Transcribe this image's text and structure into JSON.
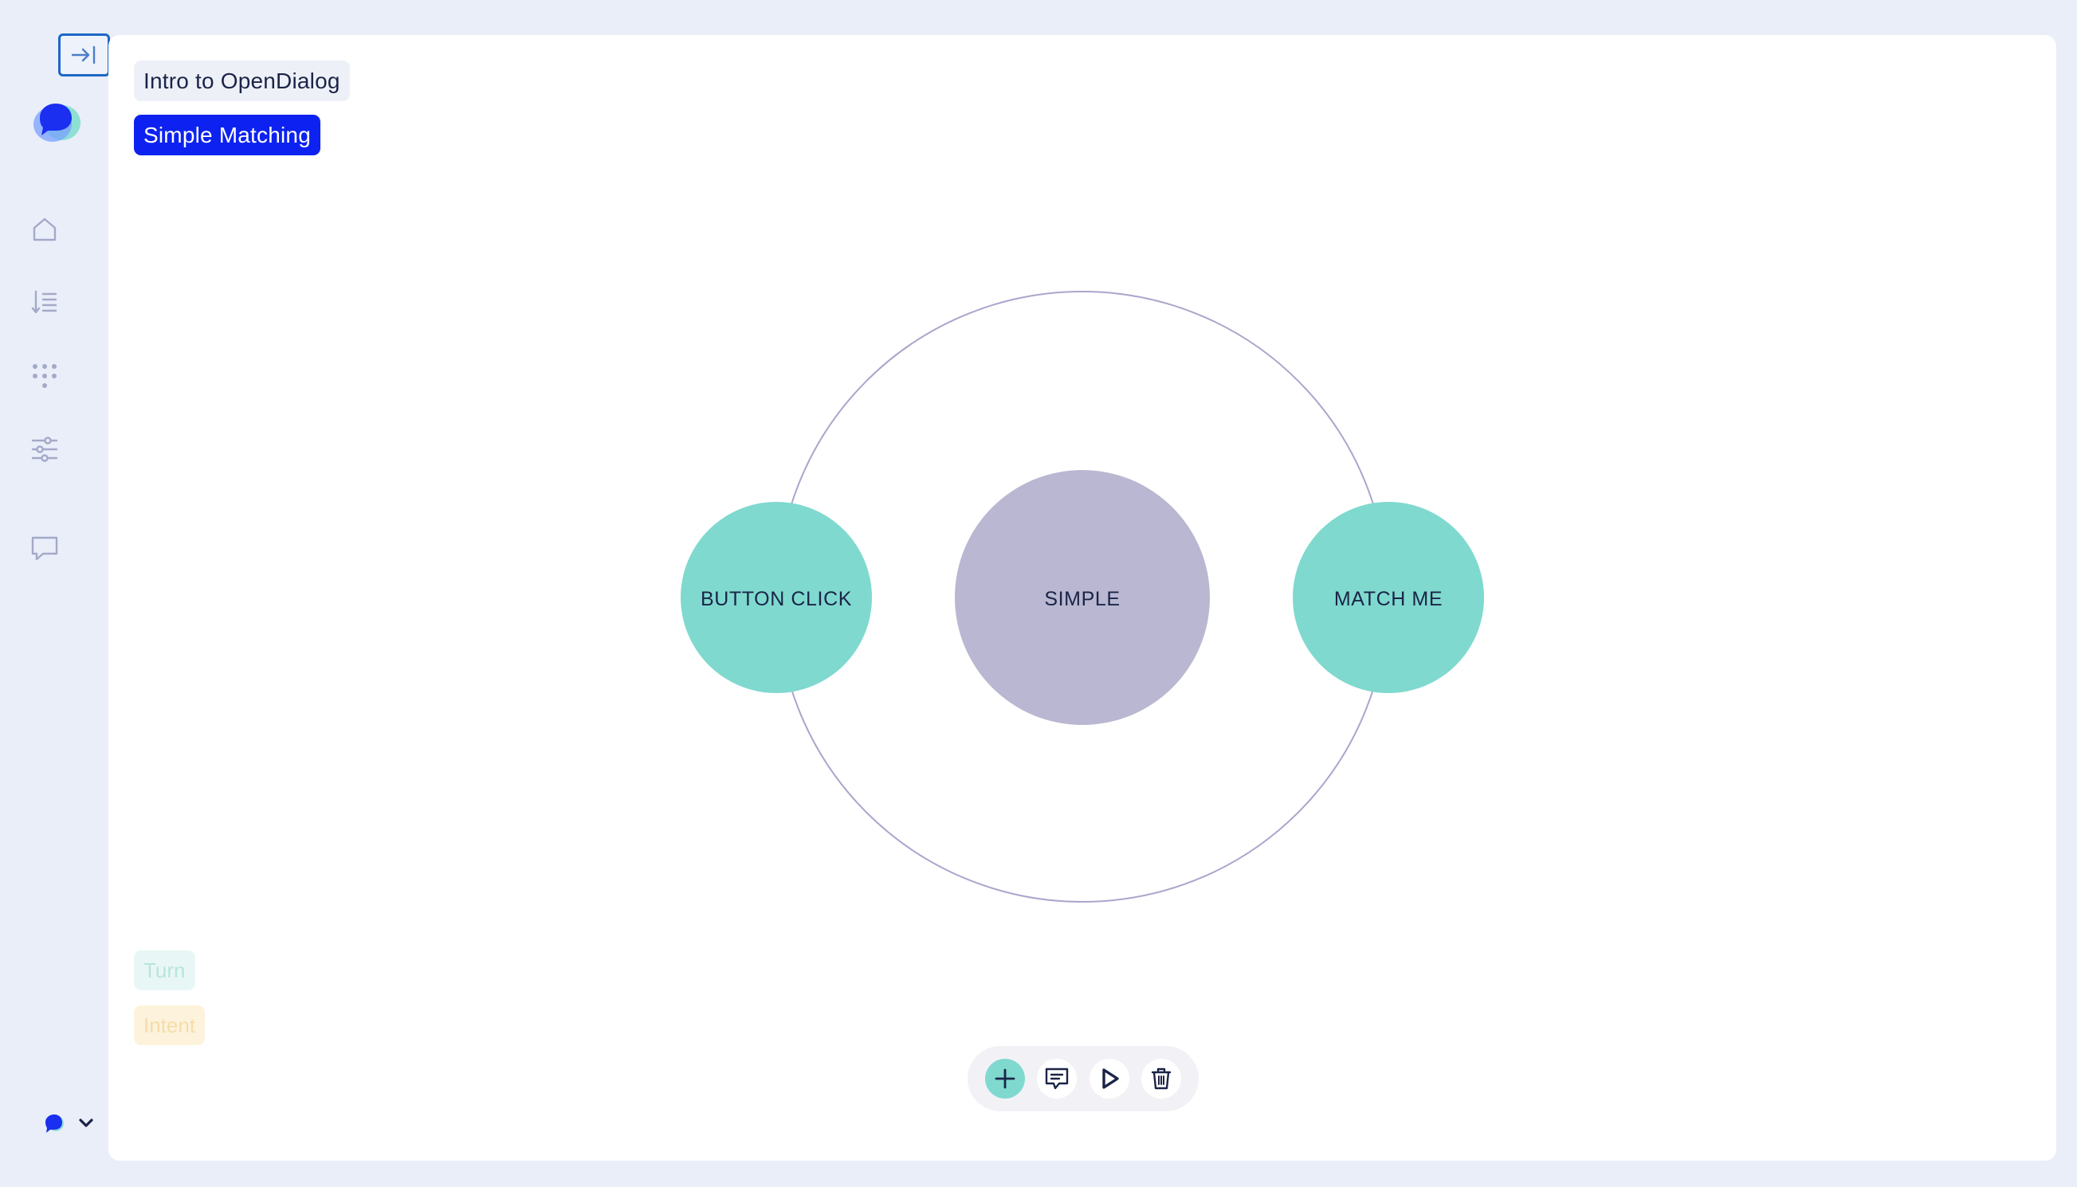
{
  "sidebar": {
    "collapse_icon": "collapse-sidebar-icon",
    "logo_icon": "opendialog-logo-icon",
    "nav": [
      {
        "name": "home",
        "icon": "home-icon"
      },
      {
        "name": "scenarios-list",
        "icon": "sort-list-icon"
      },
      {
        "name": "apps",
        "icon": "dots-grid-icon"
      },
      {
        "name": "settings",
        "icon": "sliders-icon"
      },
      {
        "name": "preview",
        "icon": "chat-bubble-icon"
      }
    ],
    "user_menu_icon": "chevron-down-icon"
  },
  "breadcrumb": {
    "scenario": "Intro to OpenDialog",
    "conversation": "Simple Matching"
  },
  "graph": {
    "center": {
      "label": "SIMPLE",
      "color": "#b9b7d1"
    },
    "children": [
      {
        "label": "BUTTON CLICK",
        "color": "#7fd9cf"
      },
      {
        "label": "MATCH ME",
        "color": "#7fd9cf"
      }
    ],
    "orbit_color": "#a9a6cc"
  },
  "legend": {
    "turn": "Turn",
    "intent": "Intent"
  },
  "toolbar": {
    "items": [
      {
        "name": "add",
        "icon": "plus-icon"
      },
      {
        "name": "message",
        "icon": "message-edit-icon"
      },
      {
        "name": "play",
        "icon": "play-icon"
      },
      {
        "name": "delete",
        "icon": "trash-icon"
      }
    ]
  },
  "colors": {
    "background": "#e9eef9",
    "accent_blue": "#0d22f0",
    "teal": "#7fd9cf",
    "lavender": "#b9b7d1",
    "text_dark": "#1b2447"
  }
}
